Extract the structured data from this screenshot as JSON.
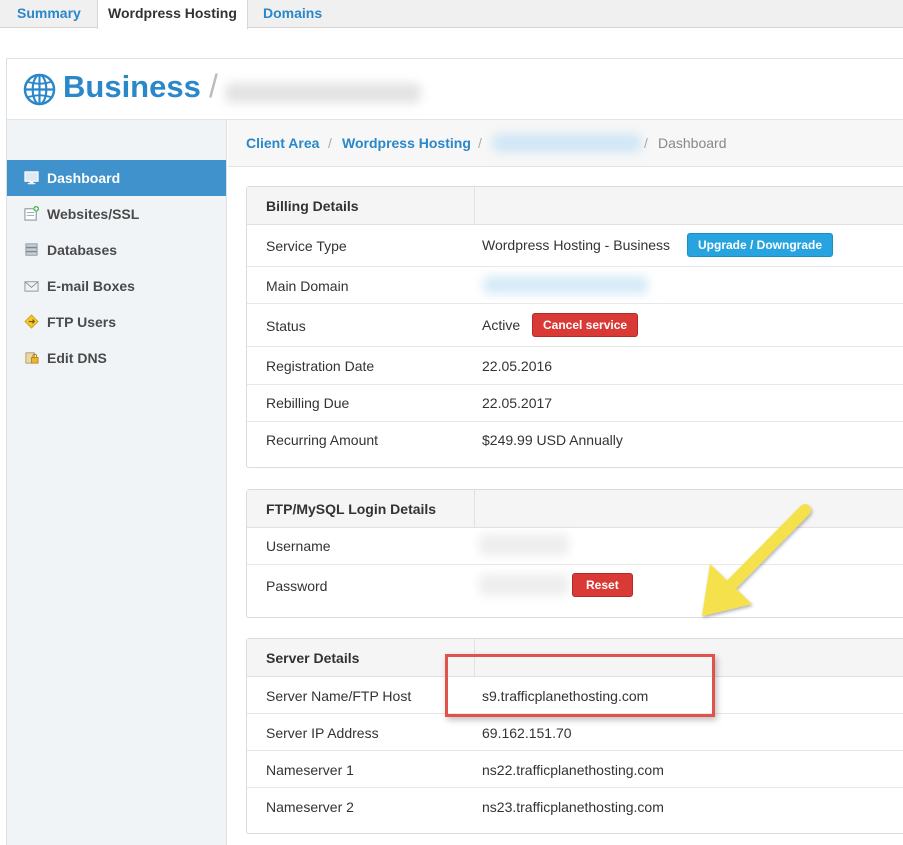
{
  "tabs": [
    {
      "label": "Summary",
      "active": false
    },
    {
      "label": "Wordpress Hosting",
      "active": true
    },
    {
      "label": "Domains",
      "active": false
    }
  ],
  "header": {
    "title": "Business",
    "separator": "/"
  },
  "sidebar": {
    "items": [
      {
        "label": "Dashboard",
        "icon": "monitor-icon",
        "active": true
      },
      {
        "label": "Websites/SSL",
        "icon": "website-add-icon",
        "active": false
      },
      {
        "label": "Databases",
        "icon": "database-icon",
        "active": false
      },
      {
        "label": "E-mail Boxes",
        "icon": "mailbox-icon",
        "active": false
      },
      {
        "label": "FTP Users",
        "icon": "ftp-users-icon",
        "active": false
      },
      {
        "label": "Edit DNS",
        "icon": "dns-lock-icon",
        "active": false
      }
    ]
  },
  "breadcrumb": {
    "items": [
      "Client Area",
      "Wordpress Hosting"
    ],
    "separator": "/",
    "current": "Dashboard"
  },
  "billing": {
    "title": "Billing Details",
    "service_type_label": "Service Type",
    "service_type_value": "Wordpress Hosting - Business",
    "upgrade_button": "Upgrade / Downgrade",
    "main_domain_label": "Main Domain",
    "status_label": "Status",
    "status_value": "Active",
    "cancel_button": "Cancel service",
    "registration_label": "Registration Date",
    "registration_value": "22.05.2016",
    "rebilling_label": "Rebilling Due",
    "rebilling_value": "22.05.2017",
    "recurring_label": "Recurring Amount",
    "recurring_value": "$249.99 USD Annually"
  },
  "ftp": {
    "title": "FTP/MySQL Login Details",
    "username_label": "Username",
    "password_label": "Password",
    "reset_button": "Reset"
  },
  "server": {
    "title": "Server Details",
    "rows": [
      {
        "label": "Server Name/FTP Host",
        "value": "s9.trafficplanethosting.com"
      },
      {
        "label": "Server IP Address",
        "value": "69.162.151.70"
      },
      {
        "label": "Nameserver 1",
        "value": "ns22.trafficplanethosting.com"
      },
      {
        "label": "Nameserver 2",
        "value": "ns23.trafficplanethosting.com"
      }
    ]
  },
  "colors": {
    "link_blue": "#2a87c9",
    "active_nav": "#3f92cc",
    "upgrade_button": "#27a3e0",
    "danger_button": "#d93a36",
    "annotation_box": "#e0534c",
    "annotation_arrow": "#f5e14b"
  }
}
